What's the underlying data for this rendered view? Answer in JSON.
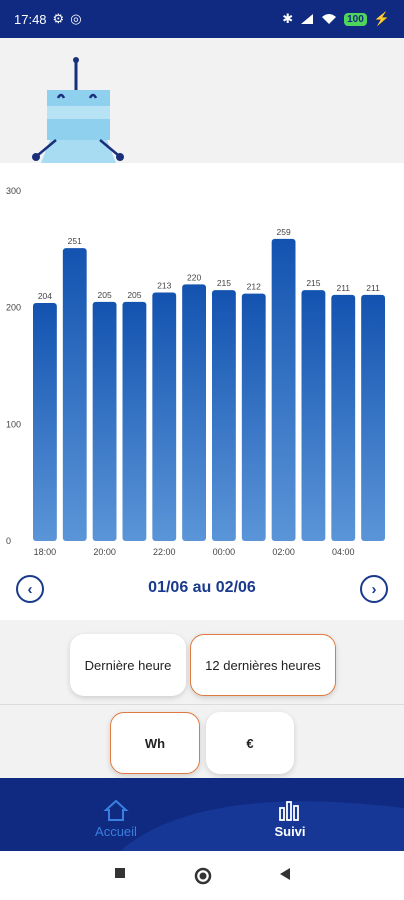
{
  "status_bar": {
    "time": "17:48",
    "battery": "100"
  },
  "chart_data": {
    "type": "bar",
    "categories": [
      "18:00",
      "19:00",
      "20:00",
      "21:00",
      "22:00",
      "23:00",
      "00:00",
      "01:00",
      "02:00",
      "03:00",
      "04:00",
      "05:00"
    ],
    "values": [
      204,
      251,
      205,
      205,
      213,
      220,
      215,
      212,
      259,
      215,
      211,
      211
    ],
    "value_labels": [
      "204",
      "251",
      "205",
      "205",
      "213",
      "220",
      "215",
      "212",
      "259",
      "215",
      "211",
      "211"
    ],
    "x_tick_labels": [
      "18:00",
      "20:00",
      "22:00",
      "00:00",
      "02:00",
      "04:00"
    ],
    "y_ticks": [
      "0",
      "100",
      "200",
      "300"
    ],
    "ylim": [
      0,
      300
    ],
    "bar_color_top": "#1353b0",
    "bar_color_bottom": "#5b95d8"
  },
  "date_nav": {
    "range_label": "01/06 au 02/06"
  },
  "period": {
    "last_hour": "Dernière heure",
    "last_12_hours": "12 dernières heures"
  },
  "unit": {
    "wh": "Wh",
    "euro": "€"
  },
  "bottom_nav": {
    "home": "Accueil",
    "tracking": "Suivi"
  },
  "colors": {
    "primary": "#0f2a80",
    "accent": "#e07a3e",
    "bar": "#1353b0"
  }
}
